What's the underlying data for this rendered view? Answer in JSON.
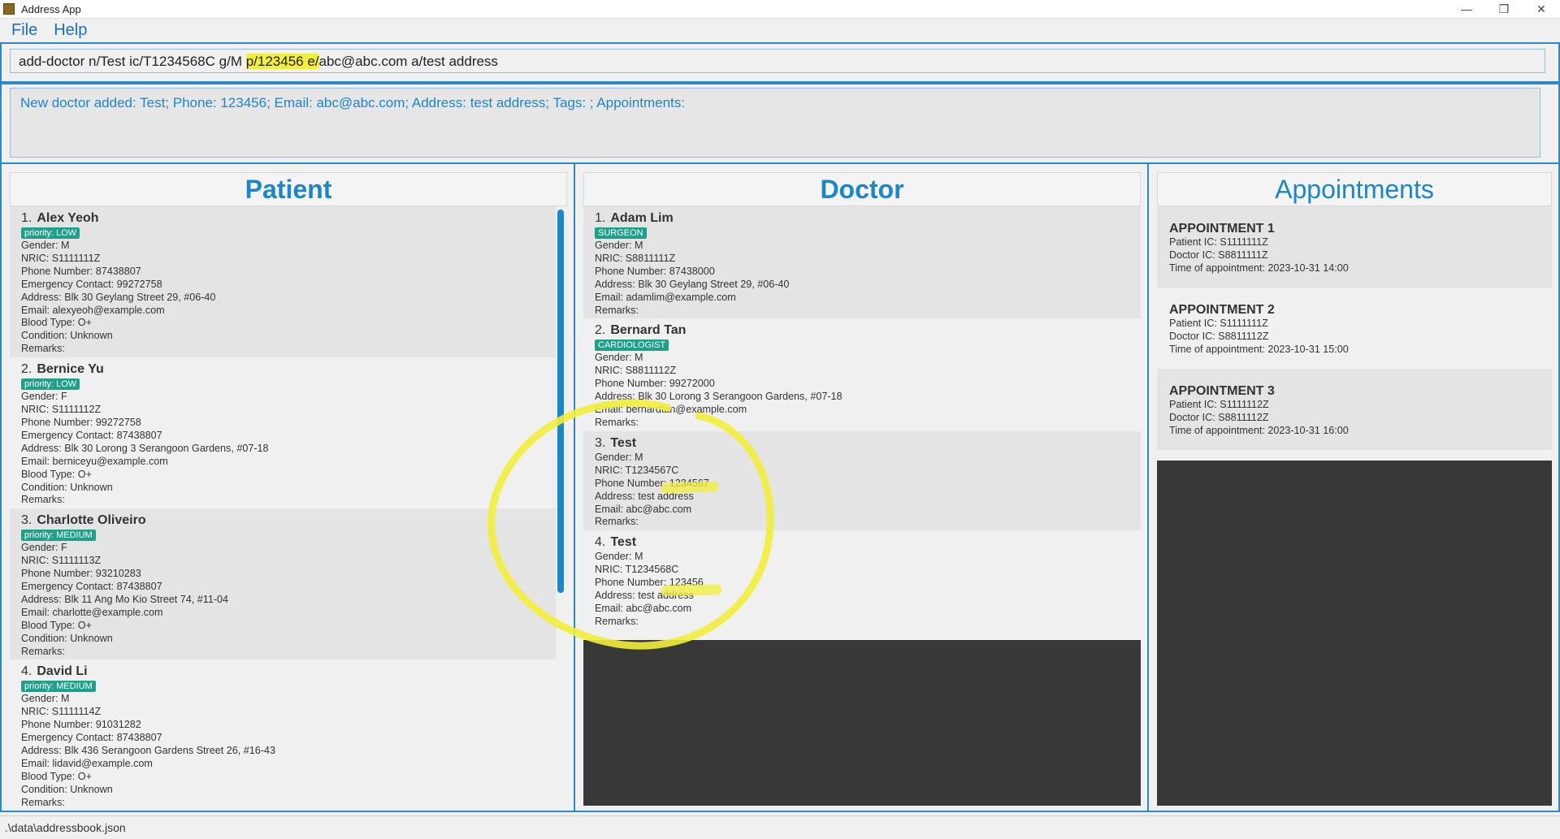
{
  "window": {
    "title": "Address App",
    "minimize": "—",
    "restore": "❐",
    "close": "✕"
  },
  "menu": {
    "file": "File",
    "help": "Help"
  },
  "command": {
    "before": "add-doctor n/Test ic/T1234568C g/M ",
    "highlight": "p/123456 e/",
    "after": "abc@abc.com a/test address"
  },
  "result": "New doctor added: Test; Phone: 123456; Email: abc@abc.com; Address: test address; Tags: ; Appointments:",
  "patients": {
    "title": "Patient",
    "items": [
      {
        "index": "1.",
        "name": "Alex Yeoh",
        "tag": "priority: LOW",
        "gender": "Gender: M",
        "nric": "NRIC: S1111111Z",
        "phone": "Phone Number: 87438807",
        "emergency": "Emergency Contact: 99272758",
        "address": "Address: Blk 30 Geylang Street 29, #06-40",
        "email": "Email: alexyeoh@example.com",
        "blood": "Blood Type: O+",
        "condition": "Condition: Unknown",
        "remarks": "Remarks:"
      },
      {
        "index": "2.",
        "name": "Bernice Yu",
        "tag": "priority: LOW",
        "gender": "Gender: F",
        "nric": "NRIC: S1111112Z",
        "phone": "Phone Number: 99272758",
        "emergency": "Emergency Contact: 87438807",
        "address": "Address: Blk 30 Lorong 3 Serangoon Gardens, #07-18",
        "email": "Email: berniceyu@example.com",
        "blood": "Blood Type: O+",
        "condition": "Condition: Unknown",
        "remarks": "Remarks:"
      },
      {
        "index": "3.",
        "name": "Charlotte Oliveiro",
        "tag": "priority: MEDIUM",
        "gender": "Gender: F",
        "nric": "NRIC: S1111113Z",
        "phone": "Phone Number: 93210283",
        "emergency": "Emergency Contact: 87438807",
        "address": "Address: Blk 11 Ang Mo Kio Street 74, #11-04",
        "email": "Email: charlotte@example.com",
        "blood": "Blood Type: O+",
        "condition": "Condition: Unknown",
        "remarks": "Remarks:"
      },
      {
        "index": "4.",
        "name": "David Li",
        "tag": "priority: MEDIUM",
        "gender": "Gender: M",
        "nric": "NRIC: S1111114Z",
        "phone": "Phone Number: 91031282",
        "emergency": "Emergency Contact: 87438807",
        "address": "Address: Blk 436 Serangoon Gardens Street 26, #16-43",
        "email": "Email: lidavid@example.com",
        "blood": "Blood Type: O+",
        "condition": "Condition: Unknown",
        "remarks": "Remarks:"
      }
    ]
  },
  "doctors": {
    "title": "Doctor",
    "items": [
      {
        "index": "1.",
        "name": "Adam Lim",
        "tag": "SURGEON",
        "gender": "Gender: M",
        "nric": "NRIC: S8811111Z",
        "phone_label": "Phone Number",
        "phone_value": ": 87438000",
        "address": "Address: Blk 30 Geylang Street 29, #06-40",
        "email": "Email: adamlim@example.com",
        "remarks": "Remarks:"
      },
      {
        "index": "2.",
        "name": "Bernard Tan",
        "tag": "CARDIOLOGIST",
        "gender": "Gender: M",
        "nric": "NRIC: S8811112Z",
        "phone_label": "Phone Number",
        "phone_value": ": 99272000",
        "address": "Address: Blk 30 Lorong 3 Serangoon Gardens, #07-18",
        "email": "Email: bernardtan@example.com",
        "remarks": "Remarks:"
      },
      {
        "index": "3.",
        "name": "Test",
        "tag": "",
        "gender": "Gender: M",
        "nric": "NRIC: T1234567C",
        "phone_label": "Phone Number",
        "phone_value": ": 1234567",
        "address": "Address: test address",
        "email": "Email: abc@abc.com",
        "remarks": "Remarks:"
      },
      {
        "index": "4.",
        "name": "Test",
        "tag": "",
        "gender": "Gender: M",
        "nric": "NRIC: T1234568C",
        "phone_label": "Phone Number",
        "phone_value": ": 123456",
        "address": "Address: test address",
        "email": "Email: abc@abc.com",
        "remarks": "Remarks:"
      }
    ]
  },
  "appointments": {
    "title": "Appointments",
    "items": [
      {
        "title": "APPOINTMENT 1",
        "patient": "Patient IC: S1111111Z",
        "doctor": "Doctor IC: S8811111Z",
        "time": "Time of appointment: 2023-10-31 14:00"
      },
      {
        "title": "APPOINTMENT 2",
        "patient": "Patient IC: S1111111Z",
        "doctor": "Doctor IC: S8811112Z",
        "time": "Time of appointment: 2023-10-31 15:00"
      },
      {
        "title": "APPOINTMENT 3",
        "patient": "Patient IC: S1111112Z",
        "doctor": "Doctor IC: S8811112Z",
        "time": "Time of appointment: 2023-10-31 16:00"
      }
    ]
  },
  "status": {
    "path": ".\\data\\addressbook.json"
  },
  "colors": {
    "accent": "#2c89c9",
    "title_text": "#1b86c9",
    "tag_bg": "#1fa08a",
    "highlighter": "#f2ee3a",
    "empty_area": "#383838"
  }
}
